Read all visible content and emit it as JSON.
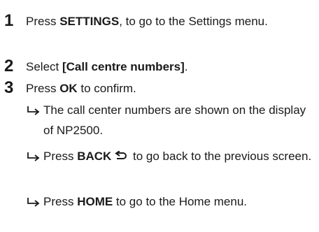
{
  "steps": [
    {
      "number": "1",
      "pre": "Press ",
      "key": "SETTINGS",
      "post": ", to go to the Settings menu."
    },
    {
      "number": "2",
      "pre": "Select ",
      "key": "[Call centre numbers]",
      "post": "."
    },
    {
      "number": "3",
      "pre": "Press ",
      "key": "OK",
      "post": " to confirm."
    }
  ],
  "results": [
    {
      "icon": "right-hook-arrow-icon",
      "text": "The call center numbers are shown on the display of NP2500."
    },
    {
      "icon": "right-hook-arrow-icon",
      "pre": "Press ",
      "key": "BACK",
      "key_icon": "back-arrow-icon",
      "post": " to go back to the previous screen."
    },
    {
      "icon": "right-hook-arrow-icon",
      "pre": "Press ",
      "key": "HOME",
      "post": " to go to the Home menu."
    }
  ]
}
